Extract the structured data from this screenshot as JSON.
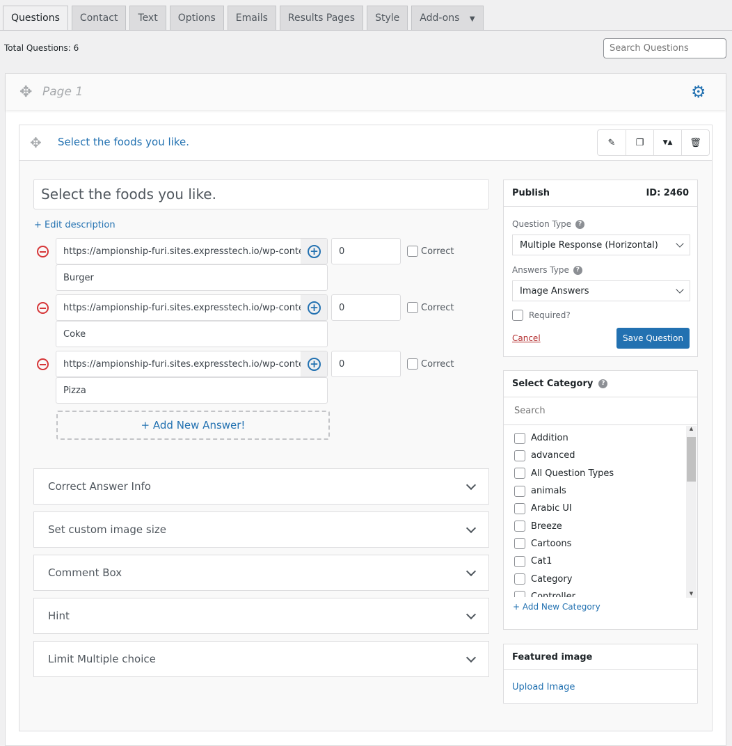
{
  "tabs": [
    {
      "label": "Questions",
      "active": true
    },
    {
      "label": "Contact"
    },
    {
      "label": "Text"
    },
    {
      "label": "Options"
    },
    {
      "label": "Emails"
    },
    {
      "label": "Results Pages"
    },
    {
      "label": "Style"
    },
    {
      "label": "Add-ons"
    }
  ],
  "total_questions": "Total Questions: 6",
  "search_placeholder": "Search Questions",
  "page": {
    "title": "Page 1"
  },
  "question": {
    "header_title": "Select the foods you like.",
    "text": "Select the foods you like.",
    "edit_description": "+ Edit description",
    "answers": [
      {
        "url": "https://ampionship-furi.sites.expresstech.io/wp-content",
        "label": "Burger",
        "points": "0",
        "correct_label": "Correct"
      },
      {
        "url": "https://ampionship-furi.sites.expresstech.io/wp-content",
        "label": "Coke",
        "points": "0",
        "correct_label": "Correct"
      },
      {
        "url": "https://ampionship-furi.sites.expresstech.io/wp-content",
        "label": "Pizza",
        "points": "0",
        "correct_label": "Correct"
      }
    ],
    "add_answer": "+ Add New Answer!",
    "accordions": [
      "Correct Answer Info",
      "Set custom image size",
      "Comment Box",
      "Hint",
      "Limit Multiple choice"
    ]
  },
  "publish": {
    "title": "Publish",
    "id": "ID: 2460",
    "question_type_label": "Question Type",
    "question_type": "Multiple Response (Horizontal)",
    "answers_type_label": "Answers Type",
    "answers_type": "Image Answers",
    "required_label": "Required?",
    "cancel": "Cancel",
    "save": "Save Question"
  },
  "category": {
    "title": "Select Category",
    "search_placeholder": "Search",
    "items": [
      "Addition",
      "advanced",
      "All Question Types",
      "animals",
      "Arabic UI",
      "Breeze",
      "Cartoons",
      "Cat1",
      "Category",
      "Controller"
    ],
    "add": "+ Add New Category"
  },
  "featured": {
    "title": "Featured image",
    "upload": "Upload Image"
  },
  "colors": {
    "accent": "#2271b1",
    "danger": "#d63638"
  }
}
